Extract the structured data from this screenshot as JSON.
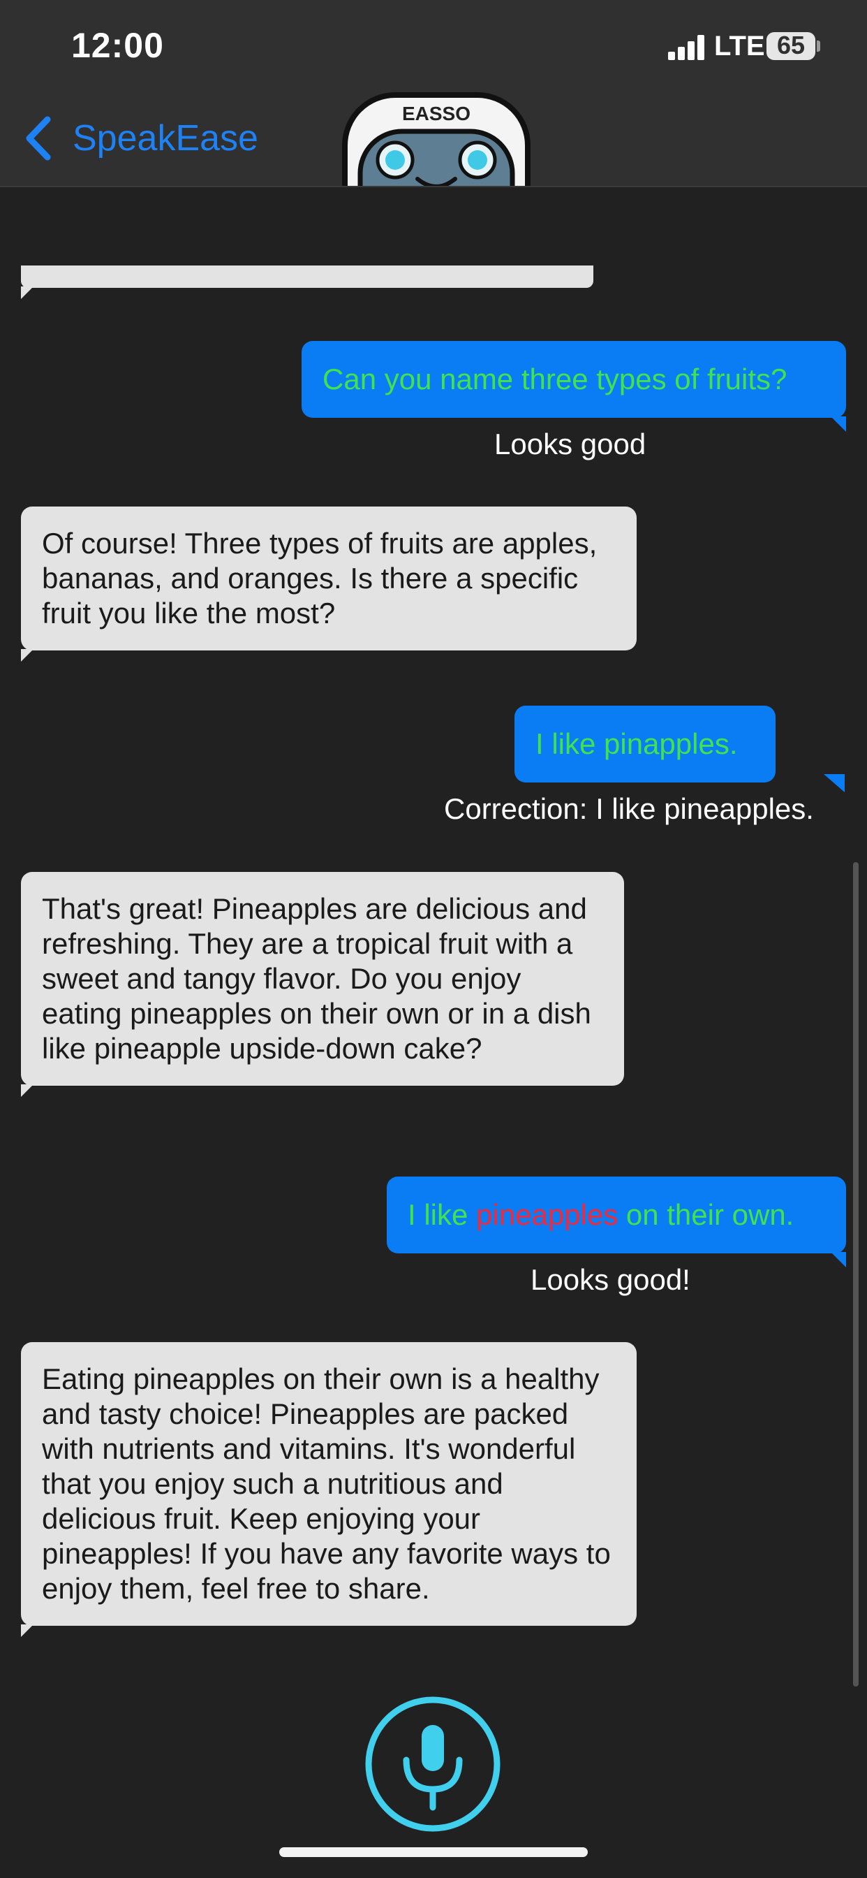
{
  "status_bar": {
    "time": "12:00",
    "network": "LTE",
    "battery": "65"
  },
  "nav": {
    "back_label": "SpeakEase",
    "avatar_text": "EASSO"
  },
  "conversation": {
    "bot_messages": [
      "",
      "Of course! Three types of fruits are apples, bananas, and oranges. Is there a specific fruit you like the most?",
      "That's great! Pineapples are delicious and refreshing. They are a tropical fruit with a sweet and tangy flavor. Do you enjoy eating pineapples on their own or in a dish like pineapple upside-down cake?",
      "Eating pineapples on their own is a healthy and tasty choice! Pineapples are packed with nutrients and vitamins. It's wonderful that you enjoy such a nutritious and delicious fruit. Keep enjoying your pineapples! If you have any favorite ways to enjoy them, feel free to share."
    ],
    "user_messages": [
      {
        "text": "Can you name three types of fruits?",
        "feedback": "Looks good"
      },
      {
        "text": "I like pinapples.",
        "feedback": "Correction: I like pineapples."
      },
      {
        "text_before": "I like ",
        "highlighted_word": "pineapples",
        "text_after": " on their own.",
        "feedback": "Looks good!"
      }
    ]
  },
  "colors": {
    "background": "#212121",
    "header": "#303030",
    "accent_blue": "#0a7cf4",
    "user_text_green": "#3fe34f",
    "highlight_red": "#ee2a3c",
    "bot_bubble": "#e3e3e3",
    "mic": "#40d0ee"
  },
  "controls": {
    "mic_icon": "microphone-icon"
  }
}
